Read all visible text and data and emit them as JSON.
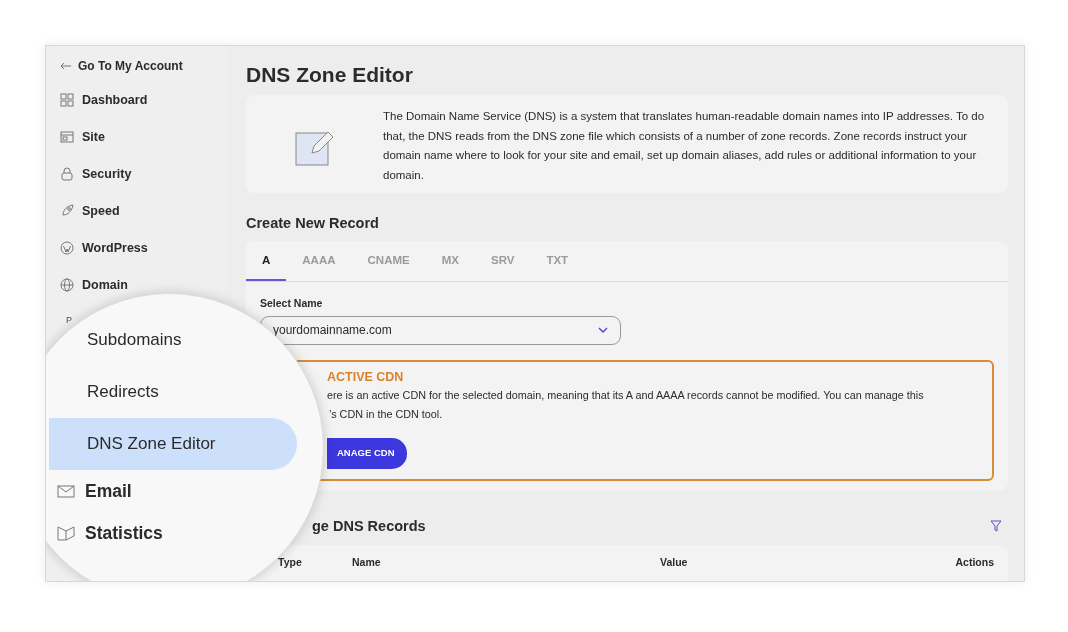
{
  "sidebar": {
    "back_link": "Go To My Account",
    "items": [
      {
        "label": "Dashboard"
      },
      {
        "label": "Site"
      },
      {
        "label": "Security"
      },
      {
        "label": "Speed"
      },
      {
        "label": "WordPress"
      },
      {
        "label": "Domain"
      }
    ],
    "peek": "P"
  },
  "magnifier": {
    "items": [
      {
        "label": "Subdomains",
        "kind": "sub",
        "selected": false
      },
      {
        "label": "Redirects",
        "kind": "sub",
        "selected": false
      },
      {
        "label": "DNS Zone Editor",
        "kind": "sub",
        "selected": true
      },
      {
        "label": "Email",
        "kind": "main",
        "selected": false
      },
      {
        "label": "Statistics",
        "kind": "main",
        "selected": false
      }
    ]
  },
  "page_title": "DNS Zone Editor",
  "intro": {
    "text": "The Domain Name Service (DNS) is a system that translates human-readable domain names into IP addresses. To do that, the DNS reads from the DNS zone file which consists of a number of zone records. Zone records instruct your domain name where to look for your site and email, set up domain aliases, add rules or additional information to your domain."
  },
  "create": {
    "title": "Create New Record",
    "tabs": [
      {
        "label": "A",
        "selected": true
      },
      {
        "label": "AAAA",
        "selected": false
      },
      {
        "label": "CNAME",
        "selected": false
      },
      {
        "label": "MX",
        "selected": false
      },
      {
        "label": "SRV",
        "selected": false
      },
      {
        "label": "TXT",
        "selected": false
      }
    ],
    "select": {
      "label": "Select Name",
      "value": "yourdomainname.com"
    },
    "alert": {
      "title": "ACTIVE CDN",
      "lines": [
        "ere is an active CDN for the selected domain, meaning that its A and AAAA records cannot be modified. You can manage this",
        "’s CDN in the CDN tool."
      ],
      "button": "ANAGE CDN"
    }
  },
  "manage": {
    "title": "ge DNS Records",
    "columns": [
      "Type",
      "Name",
      "Value",
      "Actions"
    ]
  }
}
